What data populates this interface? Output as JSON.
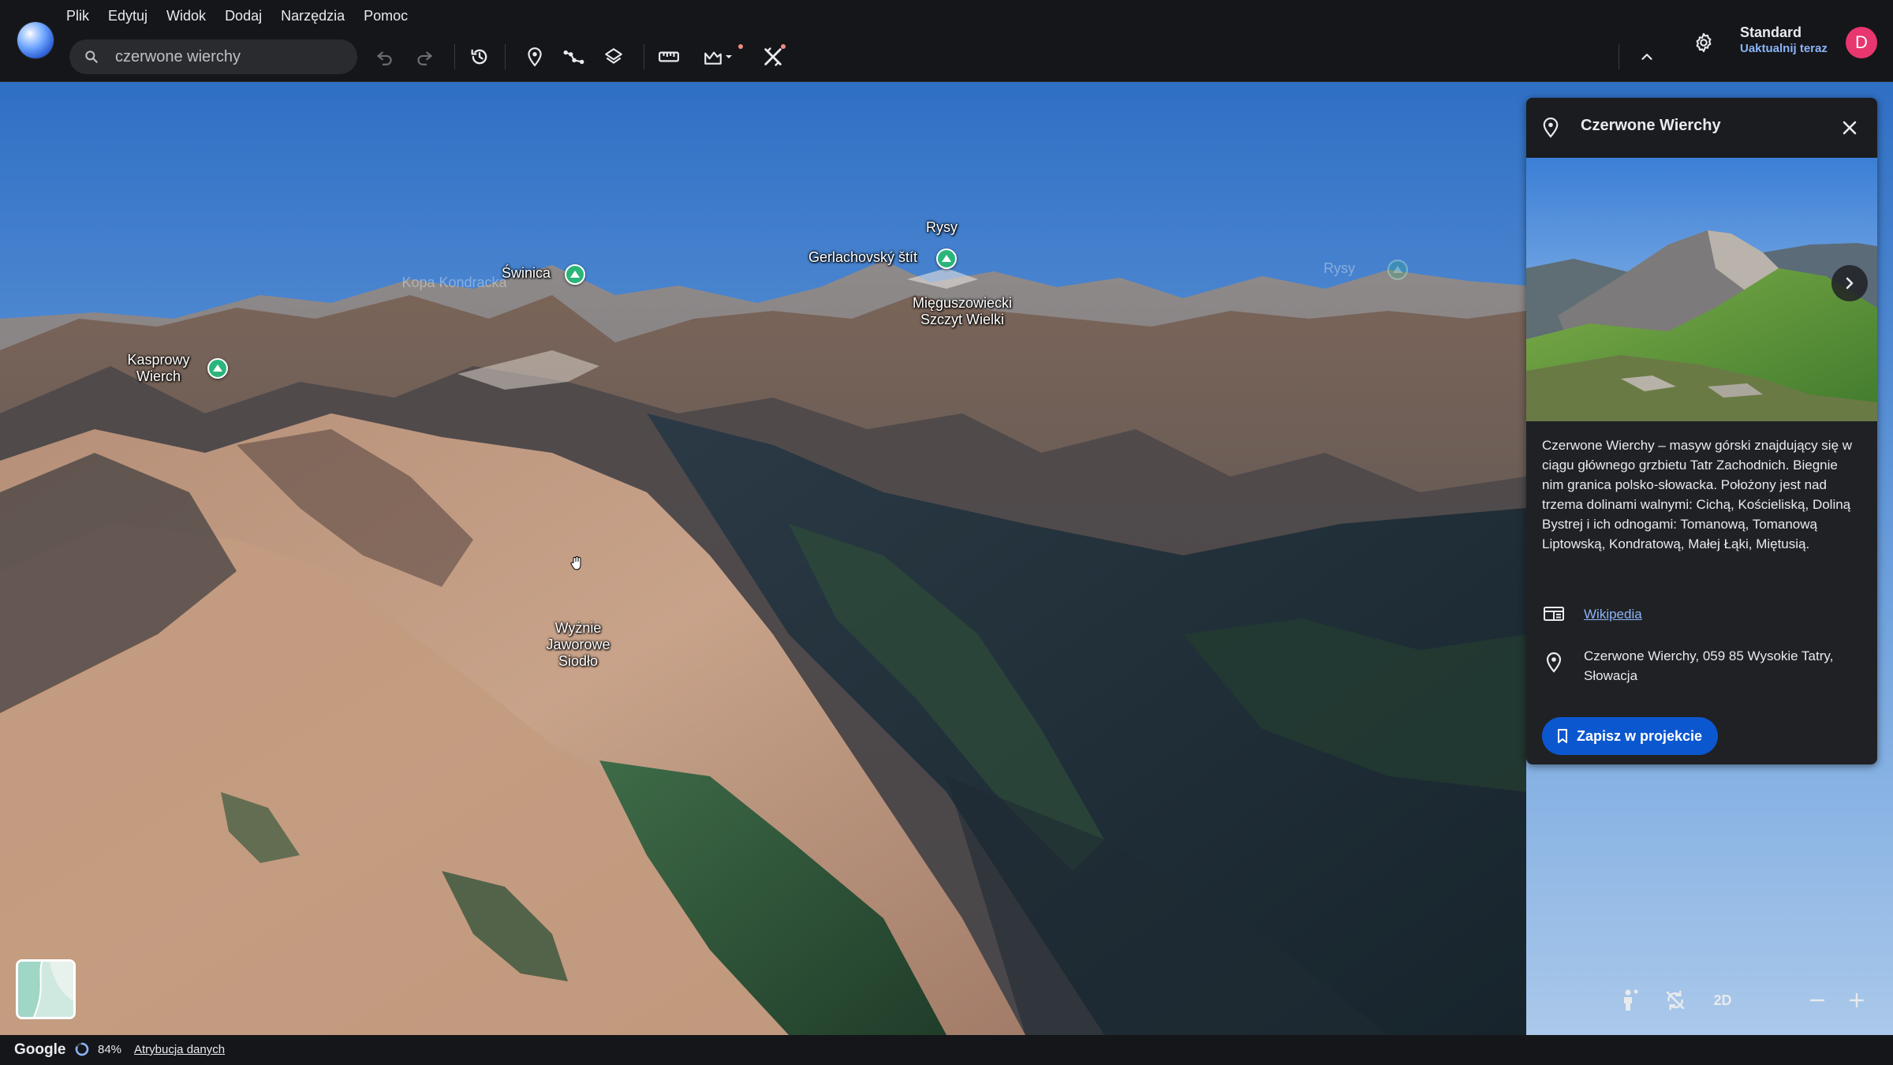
{
  "menu": {
    "items": [
      "Plik",
      "Edytuj",
      "Widok",
      "Dodaj",
      "Narzędzia",
      "Pomoc"
    ]
  },
  "search": {
    "value": "czerwone wierchy"
  },
  "account": {
    "plan": "Standard",
    "upgrade": "Uaktualnij teraz",
    "avatar_letter": "D",
    "avatar_color": "#e8366f"
  },
  "map": {
    "labels": [
      {
        "text": "Rysy"
      },
      {
        "text": "Gerlachovský štít"
      },
      {
        "text": "Świnica"
      },
      {
        "text": "Kopa Kondracka"
      },
      {
        "text": "Mięguszowiecki Szczyt Wielki"
      },
      {
        "text": "Kasprowy Wierch"
      },
      {
        "text": "Wyżnie Jaworowe Siodło"
      },
      {
        "text": "Rysy"
      }
    ]
  },
  "panel": {
    "title": "Czerwone Wierchy",
    "description": "Czerwone Wierchy – masyw górski znajdujący się w ciągu głównego grzbietu Tatr Zachodnich. Biegnie nim granica polsko-słowacka. Położony jest nad trzema dolinami walnymi: Cichą, Kościeliską, Doliną Bystrej i ich odnogami: Tomanową, Tomanową Liptowską, Kondratową, Małej Łąki, Miętusią.",
    "link_label": "Wikipedia",
    "address": "Czerwone Wierchy, 059 85 Wysokie Tatry, Słowacja",
    "save_label": "Zapisz w projekcie"
  },
  "controls": {
    "view_mode": "2D"
  },
  "status": {
    "brand": "Google",
    "loading_pct": "84%",
    "attribution": "Atrybucja danych"
  },
  "colors": {
    "accent": "#8ab4f8",
    "primary_button": "#0b57d0",
    "peak_marker": "#2bb57a"
  }
}
